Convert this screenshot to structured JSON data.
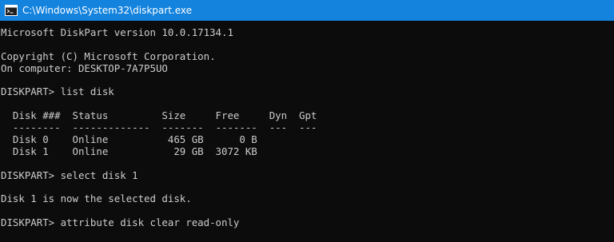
{
  "window": {
    "title": "C:\\Windows\\System32\\diskpart.exe",
    "icon": "console-app-icon"
  },
  "console": {
    "lines": [
      "Microsoft DiskPart version 10.0.17134.1",
      "",
      "Copyright (C) Microsoft Corporation.",
      "On computer: DESKTOP-7A7P5UO",
      "",
      "DISKPART> list disk",
      "",
      "  Disk ###  Status         Size     Free     Dyn  Gpt",
      "  --------  -------------  -------  -------  ---  ---",
      "  Disk 0    Online          465 GB      0 B",
      "  Disk 1    Online           29 GB  3072 KB",
      "",
      "DISKPART> select disk 1",
      "",
      "Disk 1 is now the selected disk.",
      "",
      "DISKPART> attribute disk clear read-only",
      ""
    ]
  },
  "colors": {
    "titlebar": "#1383de",
    "console_bg": "#0c0c0c",
    "console_fg": "#cccccc"
  }
}
